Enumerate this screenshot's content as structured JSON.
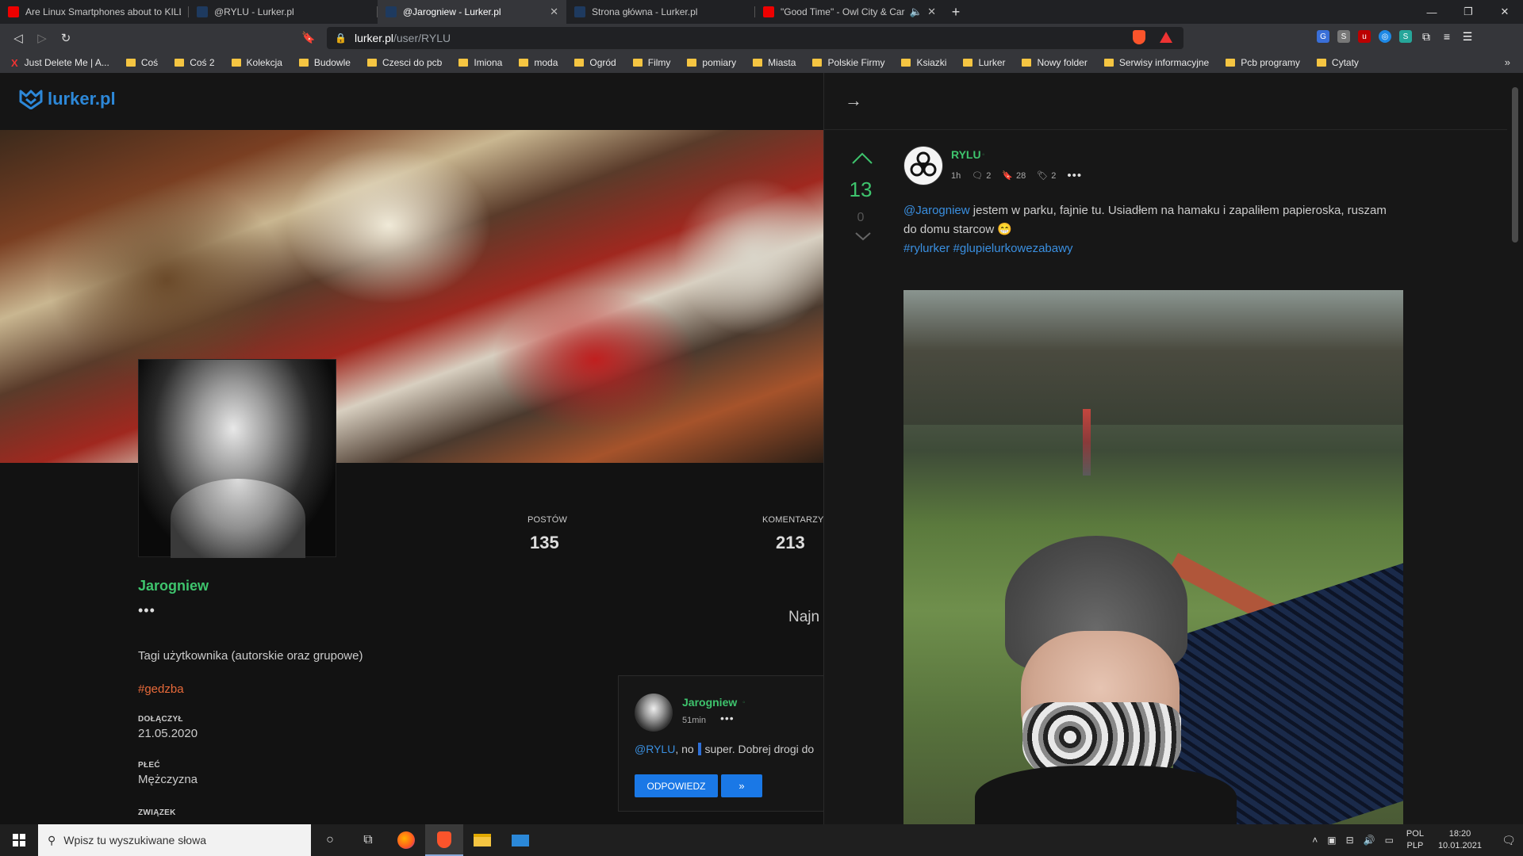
{
  "browser": {
    "tabs": [
      {
        "title": "Are Linux Smartphones about to KILL",
        "favicon": "youtube-icon",
        "active": false
      },
      {
        "title": "@RYLU - Lurker.pl",
        "favicon": "lurker-icon",
        "active": false
      },
      {
        "title": "@Jarogniew - Lurker.pl",
        "favicon": "lurker-icon",
        "active": true
      },
      {
        "title": "Strona główna - Lurker.pl",
        "favicon": "lurker-icon",
        "active": false
      },
      {
        "title": "\"Good Time\" - Owl City & Carly Ra",
        "favicon": "youtube-icon",
        "active": false
      }
    ],
    "url_host": "lurker.pl",
    "url_path": "/user/RYLU",
    "bookmarks": [
      {
        "label": "Just Delete Me | A...",
        "type": "site"
      },
      {
        "label": "Coś",
        "type": "folder"
      },
      {
        "label": "Coś 2",
        "type": "folder"
      },
      {
        "label": "Kolekcja",
        "type": "folder"
      },
      {
        "label": "Budowle",
        "type": "folder"
      },
      {
        "label": "Czesci do pcb",
        "type": "folder"
      },
      {
        "label": "Imiona",
        "type": "folder"
      },
      {
        "label": "moda",
        "type": "folder"
      },
      {
        "label": "Ogród",
        "type": "folder"
      },
      {
        "label": "Filmy",
        "type": "folder"
      },
      {
        "label": "pomiary",
        "type": "folder"
      },
      {
        "label": "Miasta",
        "type": "folder"
      },
      {
        "label": "Polskie Firmy",
        "type": "folder"
      },
      {
        "label": "Ksiazki",
        "type": "folder"
      },
      {
        "label": "Lurker",
        "type": "folder"
      },
      {
        "label": "Nowy folder",
        "type": "folder"
      },
      {
        "label": "Serwisy informacyjne",
        "type": "folder"
      },
      {
        "label": "Pcb programy",
        "type": "folder"
      },
      {
        "label": "Cytaty",
        "type": "folder"
      }
    ],
    "bookmarks_more": "»"
  },
  "site": {
    "logo_text": "lurker.pl",
    "accent": "#2d88d8"
  },
  "profile": {
    "name": "Jarogniew",
    "dots": "•••",
    "stats": {
      "posts_label": "POSTÓW",
      "posts_value": "135",
      "comments_label": "KOMENTARZY",
      "comments_value": "213"
    },
    "sort_label": "Najn",
    "tags_heading": "Tagi użytkownika (autorskie oraz grupowe)",
    "tag": "#gedzba",
    "joined_label": "DOŁĄCZYŁ",
    "joined_value": "21.05.2020",
    "gender_label": "PŁEĆ",
    "gender_value": "Mężczyzna",
    "relationship_label": "ZWIĄZEK"
  },
  "comment": {
    "author": "Jarogniew",
    "time": "51min",
    "dots": "•••",
    "mention": "@RYLU",
    "text_before_cursor": ", no ",
    "text_after_cursor": " super. Dobrej drogi do",
    "reply_label": "ODPOWIEDZ",
    "more_label": "»"
  },
  "post": {
    "votes": "13",
    "downvotes": "0",
    "author": "RYLU",
    "time": "1h",
    "comments_count": "2",
    "bookmarks_count": "28",
    "shares_count": "2",
    "dots": "•••",
    "mention": "@Jarogniew",
    "text": " jestem w parku, fajnie tu. Usiadłem na hamaku i zapaliłem papieroska, ruszam do domu starcow ",
    "emoji": "😁",
    "tag1": "#rylurker",
    "tag2": "#glupielurkowezabawy",
    "accent_green": "#3ec46d"
  },
  "taskbar": {
    "search_placeholder": "Wpisz tu wyszukiwane słowa",
    "lang_top": "POL",
    "lang_bottom": "PLP",
    "time": "18:20",
    "date": "10.01.2021"
  }
}
